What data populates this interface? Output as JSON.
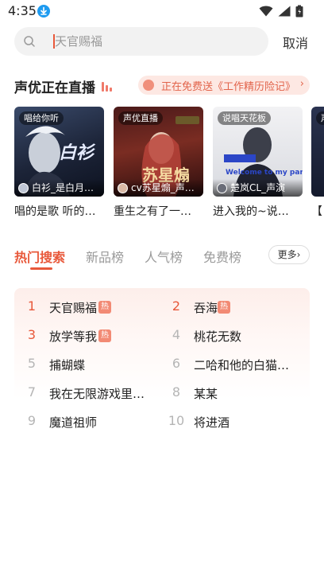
{
  "status_bar": {
    "time": "4:35"
  },
  "search": {
    "placeholder": "天官赐福",
    "cancel_label": "取消"
  },
  "live": {
    "title": "声优正在直播",
    "promo_text": "《工作精历险记》正在免费送",
    "promo_arrow": "›",
    "cards": [
      {
        "tag": "唱给你听",
        "host": "白衫_是白月…",
        "caption": "唱的是歌 听的…",
        "cover_title": "白衫"
      },
      {
        "tag": "声优直播",
        "host": "cv苏星煽_声…",
        "caption": "重生之有了一…",
        "cover_title": "苏星煽"
      },
      {
        "tag": "说唱天花板",
        "host": "楚岚CL_声演",
        "caption": "进入我的~说…",
        "cover_title": "Welcome to my party"
      },
      {
        "tag": "声",
        "host": "",
        "caption": "【",
        "cover_title": ""
      }
    ]
  },
  "tabs": [
    {
      "label": "热门搜索",
      "active": true
    },
    {
      "label": "新品榜",
      "active": false
    },
    {
      "label": "人气榜",
      "active": false
    },
    {
      "label": "免费榜",
      "active": false
    }
  ],
  "more_label": "更多",
  "more_arrow": "›",
  "hot_badge_label": "热",
  "hot_list": [
    {
      "rank": "1",
      "name": "天官赐福",
      "hot": true
    },
    {
      "rank": "2",
      "name": "吞海",
      "hot": true
    },
    {
      "rank": "3",
      "name": "放学等我",
      "hot": true
    },
    {
      "rank": "4",
      "name": "桃花无数",
      "hot": false
    },
    {
      "rank": "5",
      "name": "捕蝴蝶",
      "hot": false
    },
    {
      "rank": "6",
      "name": "二哈和他的白猫…",
      "hot": false
    },
    {
      "rank": "7",
      "name": "我在无限游戏里…",
      "hot": false
    },
    {
      "rank": "8",
      "name": "某某",
      "hot": false
    },
    {
      "rank": "9",
      "name": "魔道祖师",
      "hot": false
    },
    {
      "rank": "10",
      "name": "将进酒",
      "hot": false
    }
  ],
  "colors": {
    "accent": "#e8583a",
    "hot_badge": "#f28a74",
    "promo_bg": "#fde8e3"
  }
}
